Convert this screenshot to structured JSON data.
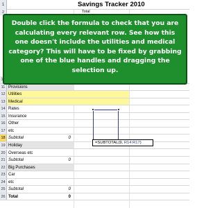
{
  "sheet": {
    "title": "Savings Tracker 2010",
    "total_header": "Total",
    "title_row_num": "1",
    "header_row_num": "2"
  },
  "callout": {
    "text": "Double click the formula to check that you are calculating every relevant row. See how this one doesn't include the utilities and medical category? This will have to be fixed by grabbing one of the blue handles and dragging the selection up."
  },
  "rows": [
    {
      "num": "10",
      "label": "Personal",
      "value": "0",
      "style": "partial"
    },
    {
      "num": "11",
      "label": "Provisions",
      "value": "",
      "style": "grey"
    },
    {
      "num": "12",
      "label": "Utilities",
      "value": "",
      "style": "yellow"
    },
    {
      "num": "13",
      "label": "Medical",
      "value": "",
      "style": "yellow"
    },
    {
      "num": "14",
      "label": "Rates",
      "value": "",
      "style": ""
    },
    {
      "num": "15",
      "label": "Insurance",
      "value": "",
      "style": ""
    },
    {
      "num": "16",
      "label": "Other",
      "value": "",
      "style": ""
    },
    {
      "num": "17",
      "label": "etc",
      "value": "",
      "style": ""
    },
    {
      "num": "18",
      "label": "Subtotal",
      "value": "0",
      "style": "italic"
    },
    {
      "num": "19",
      "label": "Holiday",
      "value": "",
      "style": "grey"
    },
    {
      "num": "20",
      "label": "Overseas etc",
      "value": "",
      "style": ""
    },
    {
      "num": "21",
      "label": "Subtotal",
      "value": "0",
      "style": "italic"
    },
    {
      "num": "22",
      "label": "Big Purchases",
      "value": "",
      "style": "grey"
    },
    {
      "num": "23",
      "label": "Car",
      "value": "",
      "style": ""
    },
    {
      "num": "24",
      "label": "etc",
      "value": "",
      "style": ""
    },
    {
      "num": "25",
      "label": "Subtotal",
      "value": "0",
      "style": "italic"
    },
    {
      "num": "26",
      "label": "Total",
      "value": "0",
      "style": "bold"
    }
  ],
  "formula": {
    "prefix": "=SUBTOTAL(9, ",
    "range": "R14:R17",
    "suffix": ")"
  },
  "colors": {
    "callout_bg": "#1e8f2c",
    "highlight_yellow": "#fff89a",
    "selection_blue": "#2d3a8c"
  }
}
